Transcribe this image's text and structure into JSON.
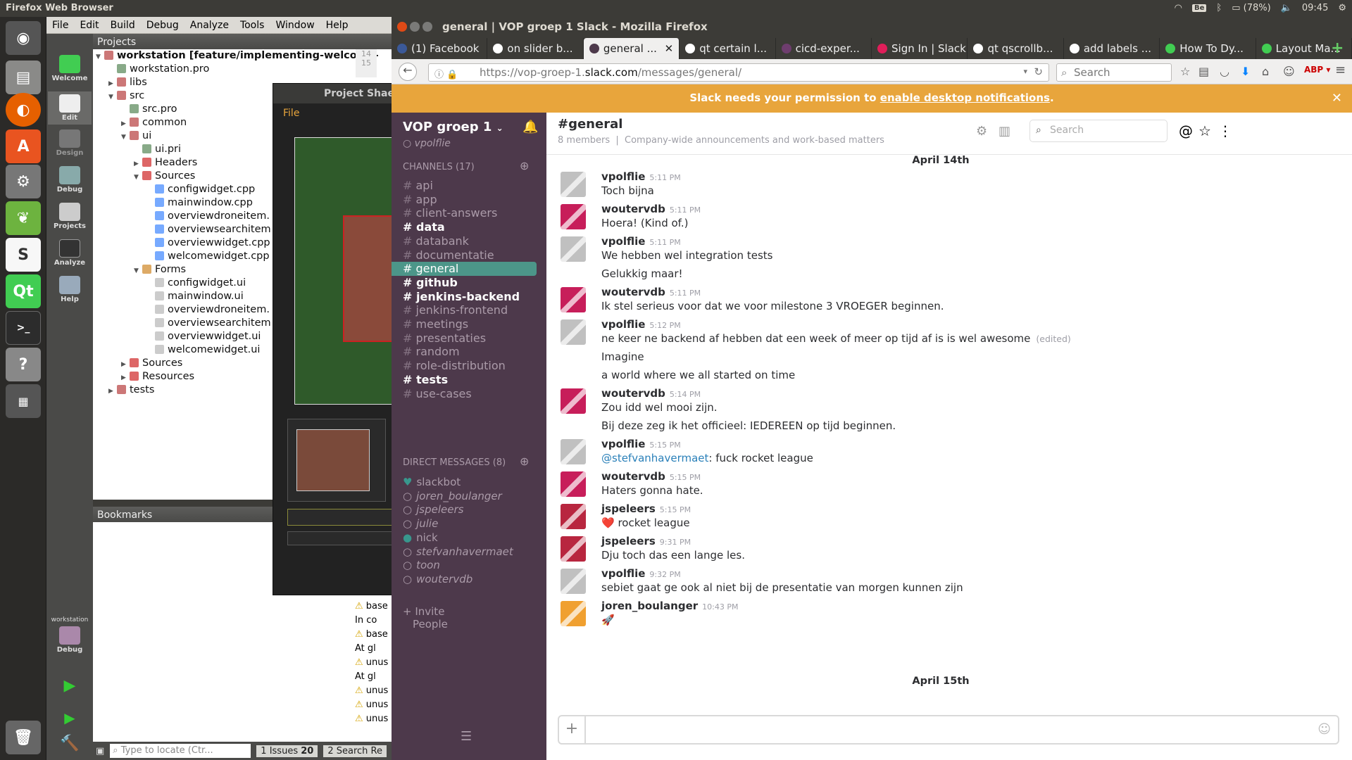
{
  "system": {
    "app_title": "Firefox Web Browser",
    "kbd": "Be",
    "battery": "(78%)",
    "time": "09:45"
  },
  "launcher": {
    "apps": [
      "dash-icon",
      "files-icon",
      "firefox-icon",
      "software-center-icon",
      "settings-icon",
      "spring-icon",
      "slack-icon",
      "qt-creator-icon",
      "terminal-icon",
      "help-icon",
      "workspace-icon",
      "trash-icon"
    ]
  },
  "qt": {
    "menu": [
      "File",
      "Edit",
      "Build",
      "Debug",
      "Analyze",
      "Tools",
      "Window",
      "Help"
    ],
    "modes": [
      "Welcome",
      "Edit",
      "Design",
      "Debug",
      "Projects",
      "Analyze",
      "Help"
    ],
    "kit_label": "workstation",
    "kit_mode": "Debug",
    "projects_title": "Projects",
    "tree": [
      {
        "label": "workstation [feature/implementing-welcome-",
        "indent": 0,
        "arrow": "▼",
        "bold": true,
        "icon": "#c77"
      },
      {
        "label": "workstation.pro",
        "indent": 1,
        "arrow": "",
        "icon": "#8a8"
      },
      {
        "label": "libs",
        "indent": 1,
        "arrow": "▶",
        "icon": "#c77"
      },
      {
        "label": "src",
        "indent": 1,
        "arrow": "▼",
        "icon": "#c77"
      },
      {
        "label": "src.pro",
        "indent": 2,
        "arrow": "",
        "icon": "#8a8"
      },
      {
        "label": "common",
        "indent": 2,
        "arrow": "▶",
        "icon": "#c77"
      },
      {
        "label": "ui",
        "indent": 2,
        "arrow": "▼",
        "icon": "#c77"
      },
      {
        "label": "ui.pri",
        "indent": 3,
        "arrow": "",
        "icon": "#8a8"
      },
      {
        "label": "Headers",
        "indent": 3,
        "arrow": "▶",
        "icon": "#d66"
      },
      {
        "label": "Sources",
        "indent": 3,
        "arrow": "▼",
        "icon": "#d66"
      },
      {
        "label": "configwidget.cpp",
        "indent": 4,
        "arrow": "",
        "icon": "#7af"
      },
      {
        "label": "mainwindow.cpp",
        "indent": 4,
        "arrow": "",
        "icon": "#7af"
      },
      {
        "label": "overviewdroneitem.",
        "indent": 4,
        "arrow": "",
        "icon": "#7af"
      },
      {
        "label": "overviewsearchitem",
        "indent": 4,
        "arrow": "",
        "icon": "#7af"
      },
      {
        "label": "overviewwidget.cpp",
        "indent": 4,
        "arrow": "",
        "icon": "#7af"
      },
      {
        "label": "welcomewidget.cpp",
        "indent": 4,
        "arrow": "",
        "icon": "#7af"
      },
      {
        "label": "Forms",
        "indent": 3,
        "arrow": "▼",
        "icon": "#da6"
      },
      {
        "label": "configwidget.ui",
        "indent": 4,
        "arrow": "",
        "icon": "#ccc"
      },
      {
        "label": "mainwindow.ui",
        "indent": 4,
        "arrow": "",
        "icon": "#ccc"
      },
      {
        "label": "overviewdroneitem.",
        "indent": 4,
        "arrow": "",
        "icon": "#ccc"
      },
      {
        "label": "overviewsearchitem",
        "indent": 4,
        "arrow": "",
        "icon": "#ccc"
      },
      {
        "label": "overviewwidget.ui",
        "indent": 4,
        "arrow": "",
        "icon": "#ccc"
      },
      {
        "label": "welcomewidget.ui",
        "indent": 4,
        "arrow": "",
        "icon": "#ccc"
      },
      {
        "label": "Sources",
        "indent": 2,
        "arrow": "▶",
        "icon": "#d66"
      },
      {
        "label": "Resources",
        "indent": 2,
        "arrow": "▶",
        "icon": "#d66"
      },
      {
        "label": "tests",
        "indent": 1,
        "arrow": "▶",
        "icon": "#c77"
      }
    ],
    "bookmarks_title": "Bookmarks",
    "locator_placeholder": "Type to locate (Ctr...",
    "issues_label": "1 Issues",
    "issues_count": "20",
    "search_label": "2 Search Re",
    "issues_lines": [
      {
        "t": "In co",
        "w": false
      },
      {
        "t": "base",
        "w": true
      },
      {
        "t": "In co",
        "w": false
      },
      {
        "t": "base",
        "w": true
      },
      {
        "t": "At gl",
        "w": false
      },
      {
        "t": "unus",
        "w": true
      },
      {
        "t": "At gl",
        "w": false
      },
      {
        "t": "unus",
        "w": true
      },
      {
        "t": "unus",
        "w": true
      },
      {
        "t": "unus",
        "w": true
      }
    ],
    "gutter": [
      "14",
      "15"
    ]
  },
  "dialog": {
    "title": "Project Shae",
    "menu": "File"
  },
  "firefox": {
    "title": "general | VOP groep 1 Slack - Mozilla Firefox",
    "tabs": [
      {
        "label": "(1) Facebook",
        "color": "#3b5998",
        "active": false
      },
      {
        "label": "on slider b...",
        "color": "#fff",
        "active": false
      },
      {
        "label": "general ...",
        "color": "#4d394b",
        "active": true
      },
      {
        "label": "qt certain l...",
        "color": "#fff",
        "active": false
      },
      {
        "label": "cicd-exper...",
        "color": "#6e3d6e",
        "active": false
      },
      {
        "label": "Sign In | Slack",
        "color": "#e01e5a",
        "active": false
      },
      {
        "label": "qt qscrollb...",
        "color": "#fff",
        "active": false
      },
      {
        "label": "add labels ...",
        "color": "#fff",
        "active": false
      },
      {
        "label": "How To Dy...",
        "color": "#41cd52",
        "active": false
      },
      {
        "label": "Layout Ma...",
        "color": "#41cd52",
        "active": false
      }
    ],
    "url_prefix": "https://vop-groep-1.",
    "url_host": "slack.com",
    "url_suffix": "/messages/general/",
    "search_placeholder": "Search",
    "banner_text": "Slack needs your permission to ",
    "banner_link": "enable desktop notifications",
    "banner_end": "."
  },
  "slack": {
    "team": "VOP groep 1",
    "user": "vpolflie",
    "channels_label": "CHANNELS",
    "channels_count": "(17)",
    "channels": [
      {
        "name": "api",
        "bold": false
      },
      {
        "name": "app",
        "bold": false
      },
      {
        "name": "client-answers",
        "bold": false
      },
      {
        "name": "data",
        "bold": true
      },
      {
        "name": "databank",
        "bold": false
      },
      {
        "name": "documentatie",
        "bold": false
      },
      {
        "name": "general",
        "bold": false,
        "selected": true
      },
      {
        "name": "github",
        "bold": true
      },
      {
        "name": "jenkins-backend",
        "bold": true
      },
      {
        "name": "jenkins-frontend",
        "bold": false
      },
      {
        "name": "meetings",
        "bold": false
      },
      {
        "name": "presentaties",
        "bold": false
      },
      {
        "name": "random",
        "bold": false
      },
      {
        "name": "role-distribution",
        "bold": false
      },
      {
        "name": "tests",
        "bold": true
      },
      {
        "name": "use-cases",
        "bold": false
      }
    ],
    "dm_label": "DIRECT MESSAGES",
    "dm_count": "(8)",
    "dms": [
      {
        "name": "slackbot",
        "status": "♥",
        "on": true
      },
      {
        "name": "joren_boulanger",
        "status": "○",
        "on": false
      },
      {
        "name": "jspeleers",
        "status": "○",
        "on": false
      },
      {
        "name": "julie",
        "status": "○",
        "on": false
      },
      {
        "name": "nick",
        "status": "●",
        "on": true
      },
      {
        "name": "stefvanhavermaet",
        "status": "○",
        "on": false
      },
      {
        "name": "toon",
        "status": "○",
        "on": false
      },
      {
        "name": "woutervdb",
        "status": "○",
        "on": false
      }
    ],
    "invite": "+ Invite",
    "invite2": "People",
    "channel_title": "#general",
    "members": "8 members",
    "purpose": "Company-wide announcements and work-based matters",
    "header_search": "Search",
    "day1": "April 14th",
    "day2": "April 15th",
    "messages": [
      {
        "user": "vpolflie",
        "time": "5:11 PM",
        "lines": [
          "Toch bijna"
        ],
        "avatar": "#c0c0c0"
      },
      {
        "user": "woutervdb",
        "time": "5:11 PM",
        "lines": [
          "Hoera! (Kind of.)"
        ],
        "avatar": "#c71e5a"
      },
      {
        "user": "vpolflie",
        "time": "5:11 PM",
        "lines": [
          "We hebben wel integration tests",
          "Gelukkig maar!"
        ],
        "avatar": "#c0c0c0"
      },
      {
        "user": "woutervdb",
        "time": "5:11 PM",
        "lines": [
          "Ik stel serieus voor dat we voor milestone 3 VROEGER beginnen."
        ],
        "avatar": "#c71e5a"
      },
      {
        "user": "vpolflie",
        "time": "5:12 PM",
        "lines": [
          "ne keer ne backend af hebben dat een week of meer op tijd af is is wel awesome",
          "Imagine",
          "a world where we all started on time"
        ],
        "edited": "(edited)",
        "avatar": "#c0c0c0"
      },
      {
        "user": "woutervdb",
        "time": "5:14 PM",
        "lines": [
          "Zou idd wel mooi zijn.",
          "Bij deze zeg ik het officieel: IEDEREEN op tijd beginnen."
        ],
        "avatar": "#c71e5a"
      },
      {
        "user": "vpolflie",
        "time": "5:15 PM",
        "mention": "@stefvanhavermaet",
        "lines": [
          ": fuck rocket league"
        ],
        "avatar": "#c0c0c0"
      },
      {
        "user": "woutervdb",
        "time": "5:15 PM",
        "lines": [
          "Haters gonna hate."
        ],
        "avatar": "#c71e5a"
      },
      {
        "user": "jspeleers",
        "time": "5:15 PM",
        "lines": [
          "❤️ rocket league"
        ],
        "avatar": "#b8263f"
      },
      {
        "user": "jspeleers",
        "time": "9:31 PM",
        "lines": [
          "Dju toch das een lange les."
        ],
        "avatar": "#b8263f"
      },
      {
        "user": "vpolflie",
        "time": "9:32 PM",
        "lines": [
          "sebiet gaat ge ook al niet bij de presentatie van morgen kunnen zijn"
        ],
        "avatar": "#c0c0c0"
      },
      {
        "user": "joren_boulanger",
        "time": "10:43 PM",
        "lines": [
          "🚀"
        ],
        "avatar": "#f0a030"
      }
    ]
  }
}
